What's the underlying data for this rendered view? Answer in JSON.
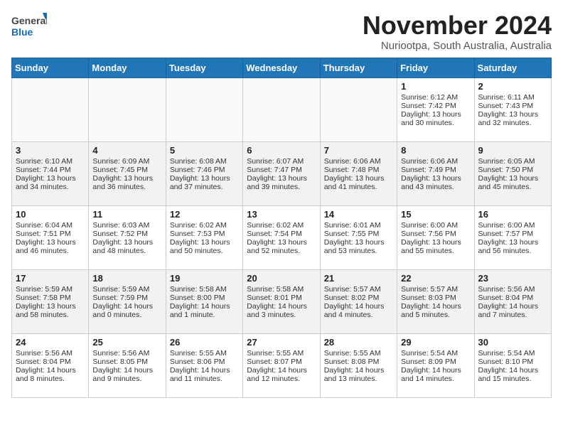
{
  "header": {
    "logo_general": "General",
    "logo_blue": "Blue",
    "month_title": "November 2024",
    "subtitle": "Nuriootpa, South Australia, Australia"
  },
  "days_of_week": [
    "Sunday",
    "Monday",
    "Tuesday",
    "Wednesday",
    "Thursday",
    "Friday",
    "Saturday"
  ],
  "weeks": [
    [
      {
        "day": "",
        "info": ""
      },
      {
        "day": "",
        "info": ""
      },
      {
        "day": "",
        "info": ""
      },
      {
        "day": "",
        "info": ""
      },
      {
        "day": "",
        "info": ""
      },
      {
        "day": "1",
        "info": "Sunrise: 6:12 AM\nSunset: 7:42 PM\nDaylight: 13 hours and 30 minutes."
      },
      {
        "day": "2",
        "info": "Sunrise: 6:11 AM\nSunset: 7:43 PM\nDaylight: 13 hours and 32 minutes."
      }
    ],
    [
      {
        "day": "3",
        "info": "Sunrise: 6:10 AM\nSunset: 7:44 PM\nDaylight: 13 hours and 34 minutes."
      },
      {
        "day": "4",
        "info": "Sunrise: 6:09 AM\nSunset: 7:45 PM\nDaylight: 13 hours and 36 minutes."
      },
      {
        "day": "5",
        "info": "Sunrise: 6:08 AM\nSunset: 7:46 PM\nDaylight: 13 hours and 37 minutes."
      },
      {
        "day": "6",
        "info": "Sunrise: 6:07 AM\nSunset: 7:47 PM\nDaylight: 13 hours and 39 minutes."
      },
      {
        "day": "7",
        "info": "Sunrise: 6:06 AM\nSunset: 7:48 PM\nDaylight: 13 hours and 41 minutes."
      },
      {
        "day": "8",
        "info": "Sunrise: 6:06 AM\nSunset: 7:49 PM\nDaylight: 13 hours and 43 minutes."
      },
      {
        "day": "9",
        "info": "Sunrise: 6:05 AM\nSunset: 7:50 PM\nDaylight: 13 hours and 45 minutes."
      }
    ],
    [
      {
        "day": "10",
        "info": "Sunrise: 6:04 AM\nSunset: 7:51 PM\nDaylight: 13 hours and 46 minutes."
      },
      {
        "day": "11",
        "info": "Sunrise: 6:03 AM\nSunset: 7:52 PM\nDaylight: 13 hours and 48 minutes."
      },
      {
        "day": "12",
        "info": "Sunrise: 6:02 AM\nSunset: 7:53 PM\nDaylight: 13 hours and 50 minutes."
      },
      {
        "day": "13",
        "info": "Sunrise: 6:02 AM\nSunset: 7:54 PM\nDaylight: 13 hours and 52 minutes."
      },
      {
        "day": "14",
        "info": "Sunrise: 6:01 AM\nSunset: 7:55 PM\nDaylight: 13 hours and 53 minutes."
      },
      {
        "day": "15",
        "info": "Sunrise: 6:00 AM\nSunset: 7:56 PM\nDaylight: 13 hours and 55 minutes."
      },
      {
        "day": "16",
        "info": "Sunrise: 6:00 AM\nSunset: 7:57 PM\nDaylight: 13 hours and 56 minutes."
      }
    ],
    [
      {
        "day": "17",
        "info": "Sunrise: 5:59 AM\nSunset: 7:58 PM\nDaylight: 13 hours and 58 minutes."
      },
      {
        "day": "18",
        "info": "Sunrise: 5:59 AM\nSunset: 7:59 PM\nDaylight: 14 hours and 0 minutes."
      },
      {
        "day": "19",
        "info": "Sunrise: 5:58 AM\nSunset: 8:00 PM\nDaylight: 14 hours and 1 minute."
      },
      {
        "day": "20",
        "info": "Sunrise: 5:58 AM\nSunset: 8:01 PM\nDaylight: 14 hours and 3 minutes."
      },
      {
        "day": "21",
        "info": "Sunrise: 5:57 AM\nSunset: 8:02 PM\nDaylight: 14 hours and 4 minutes."
      },
      {
        "day": "22",
        "info": "Sunrise: 5:57 AM\nSunset: 8:03 PM\nDaylight: 14 hours and 5 minutes."
      },
      {
        "day": "23",
        "info": "Sunrise: 5:56 AM\nSunset: 8:04 PM\nDaylight: 14 hours and 7 minutes."
      }
    ],
    [
      {
        "day": "24",
        "info": "Sunrise: 5:56 AM\nSunset: 8:04 PM\nDaylight: 14 hours and 8 minutes."
      },
      {
        "day": "25",
        "info": "Sunrise: 5:56 AM\nSunset: 8:05 PM\nDaylight: 14 hours and 9 minutes."
      },
      {
        "day": "26",
        "info": "Sunrise: 5:55 AM\nSunset: 8:06 PM\nDaylight: 14 hours and 11 minutes."
      },
      {
        "day": "27",
        "info": "Sunrise: 5:55 AM\nSunset: 8:07 PM\nDaylight: 14 hours and 12 minutes."
      },
      {
        "day": "28",
        "info": "Sunrise: 5:55 AM\nSunset: 8:08 PM\nDaylight: 14 hours and 13 minutes."
      },
      {
        "day": "29",
        "info": "Sunrise: 5:54 AM\nSunset: 8:09 PM\nDaylight: 14 hours and 14 minutes."
      },
      {
        "day": "30",
        "info": "Sunrise: 5:54 AM\nSunset: 8:10 PM\nDaylight: 14 hours and 15 minutes."
      }
    ]
  ]
}
